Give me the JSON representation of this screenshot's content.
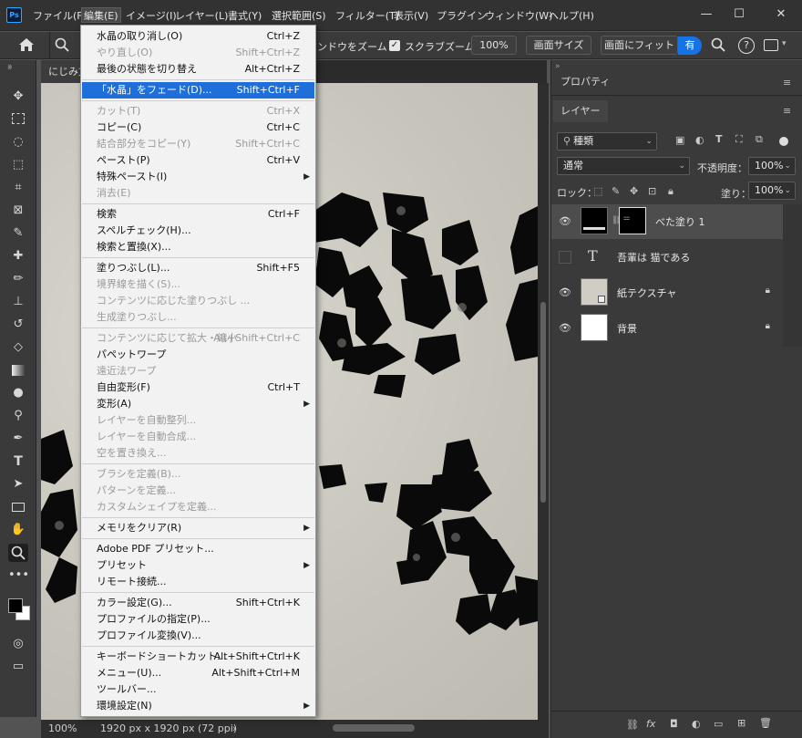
{
  "app": {
    "logo": "Ps"
  },
  "menubar": [
    {
      "label": "ファイル(F)"
    },
    {
      "label": "編集(E)",
      "active": true
    },
    {
      "label": "イメージ(I)"
    },
    {
      "label": "レイヤー(L)"
    },
    {
      "label": "書式(Y)"
    },
    {
      "label": "選択範囲(S)"
    },
    {
      "label": "フィルター(T)"
    },
    {
      "label": "表示(V)"
    },
    {
      "label": "プラグイン"
    },
    {
      "label": "ウィンドウ(W)"
    },
    {
      "label": "ヘルプ(H)"
    }
  ],
  "window_buttons": {
    "minimize": "—",
    "maximize": "☐",
    "close": "✕"
  },
  "options_bar": {
    "zoom_windows_partial": "ンドウをズーム",
    "scrubby_zoom_label": "スクラブズーム",
    "scrubby_zoom_checked": true,
    "zoom_value": "100%",
    "fit_screen": "画面サイズ",
    "fill_screen": "画面にフィット",
    "share_partial": "有"
  },
  "document_tab": {
    "title": "にじみ文"
  },
  "status_bar": {
    "zoom": "100%",
    "doc_info": "1920 px x 1920 px (72 ppi)",
    "arrow": "›"
  },
  "edit_menu": {
    "groups": [
      [
        {
          "label": "水晶の取り消し(O)",
          "shortcut": "Ctrl+Z",
          "disabled": false
        },
        {
          "label": "やり直し(O)",
          "shortcut": "Shift+Ctrl+Z",
          "disabled": true
        },
        {
          "label": "最後の状態を切り替え",
          "shortcut": "Alt+Ctrl+Z",
          "disabled": false
        }
      ],
      [
        {
          "label": "「水晶」をフェード(D)...",
          "shortcut": "Shift+Ctrl+F",
          "disabled": false,
          "highlighted": true
        }
      ],
      [
        {
          "label": "カット(T)",
          "shortcut": "Ctrl+X",
          "disabled": true
        },
        {
          "label": "コピー(C)",
          "shortcut": "Ctrl+C",
          "disabled": false
        },
        {
          "label": "結合部分をコピー(Y)",
          "shortcut": "Shift+Ctrl+C",
          "disabled": true
        },
        {
          "label": "ペースト(P)",
          "shortcut": "Ctrl+V",
          "disabled": false
        },
        {
          "label": "特殊ペースト(I)",
          "shortcut": "",
          "disabled": false,
          "submenu": true
        },
        {
          "label": "消去(E)",
          "shortcut": "",
          "disabled": true
        }
      ],
      [
        {
          "label": "検索",
          "shortcut": "Ctrl+F",
          "disabled": false
        },
        {
          "label": "スペルチェック(H)...",
          "shortcut": "",
          "disabled": false
        },
        {
          "label": "検索と置換(X)...",
          "shortcut": "",
          "disabled": false
        }
      ],
      [
        {
          "label": "塗りつぶし(L)...",
          "shortcut": "Shift+F5",
          "disabled": false
        },
        {
          "label": "境界線を描く(S)...",
          "shortcut": "",
          "disabled": true
        },
        {
          "label": "コンテンツに応じた塗りつぶし ...",
          "shortcut": "",
          "disabled": true
        },
        {
          "label": "生成塗りつぶし...",
          "shortcut": "",
          "disabled": true
        }
      ],
      [
        {
          "label": "コンテンツに応じて拡大・縮小",
          "shortcut": "Alt+Shift+Ctrl+C",
          "disabled": true
        },
        {
          "label": "パペットワープ",
          "shortcut": "",
          "disabled": false
        },
        {
          "label": "遠近法ワープ",
          "shortcut": "",
          "disabled": true
        },
        {
          "label": "自由変形(F)",
          "shortcut": "Ctrl+T",
          "disabled": false
        },
        {
          "label": "変形(A)",
          "shortcut": "",
          "disabled": false,
          "submenu": true
        },
        {
          "label": "レイヤーを自動整列...",
          "shortcut": "",
          "disabled": true
        },
        {
          "label": "レイヤーを自動合成...",
          "shortcut": "",
          "disabled": true
        },
        {
          "label": "空を置き換え...",
          "shortcut": "",
          "disabled": true
        }
      ],
      [
        {
          "label": "ブラシを定義(B)...",
          "shortcut": "",
          "disabled": true
        },
        {
          "label": "パターンを定義...",
          "shortcut": "",
          "disabled": true
        },
        {
          "label": "カスタムシェイプを定義...",
          "shortcut": "",
          "disabled": true
        }
      ],
      [
        {
          "label": "メモリをクリア(R)",
          "shortcut": "",
          "disabled": false,
          "submenu": true
        }
      ],
      [
        {
          "label": "Adobe PDF プリセット...",
          "shortcut": "",
          "disabled": false
        },
        {
          "label": "プリセット",
          "shortcut": "",
          "disabled": false,
          "submenu": true
        },
        {
          "label": "リモート接続...",
          "shortcut": "",
          "disabled": false
        }
      ],
      [
        {
          "label": "カラー設定(G)...",
          "shortcut": "Shift+Ctrl+K",
          "disabled": false
        },
        {
          "label": "プロファイルの指定(P)...",
          "shortcut": "",
          "disabled": false
        },
        {
          "label": "プロファイル変換(V)...",
          "shortcut": "",
          "disabled": false
        }
      ],
      [
        {
          "label": "キーボードショートカット...",
          "shortcut": "Alt+Shift+Ctrl+K",
          "disabled": false
        },
        {
          "label": "メニュー(U)...",
          "shortcut": "Alt+Shift+Ctrl+M",
          "disabled": false
        },
        {
          "label": "ツールバー...",
          "shortcut": "",
          "disabled": false
        },
        {
          "label": "環境設定(N)",
          "shortcut": "",
          "disabled": false,
          "submenu": true
        }
      ]
    ]
  },
  "panels": {
    "properties_tab": "プロパティ",
    "layers_tab": "レイヤー",
    "filter_kind": "種類",
    "blend_mode": "通常",
    "opacity_label": "不透明度：",
    "opacity_value": "100%",
    "lock_label": "ロック：",
    "fill_label": "塗り：",
    "fill_value": "100%",
    "layers": [
      {
        "name": "べた塗り 1",
        "type": "fill",
        "visible": true,
        "selected": true,
        "locked": false
      },
      {
        "name": "吾輩は 猫である",
        "type": "text",
        "visible": false,
        "selected": false,
        "locked": false
      },
      {
        "name": "紙テクスチャ",
        "type": "image",
        "visible": true,
        "selected": false,
        "locked": true
      },
      {
        "name": "背景",
        "type": "background",
        "visible": true,
        "selected": false,
        "locked": true
      }
    ]
  },
  "colors": {
    "accent": "#1e6fd9",
    "share_button": "#1473e6",
    "panel_bg": "#3a3a3a",
    "menu_bg": "#f2f2f2"
  }
}
